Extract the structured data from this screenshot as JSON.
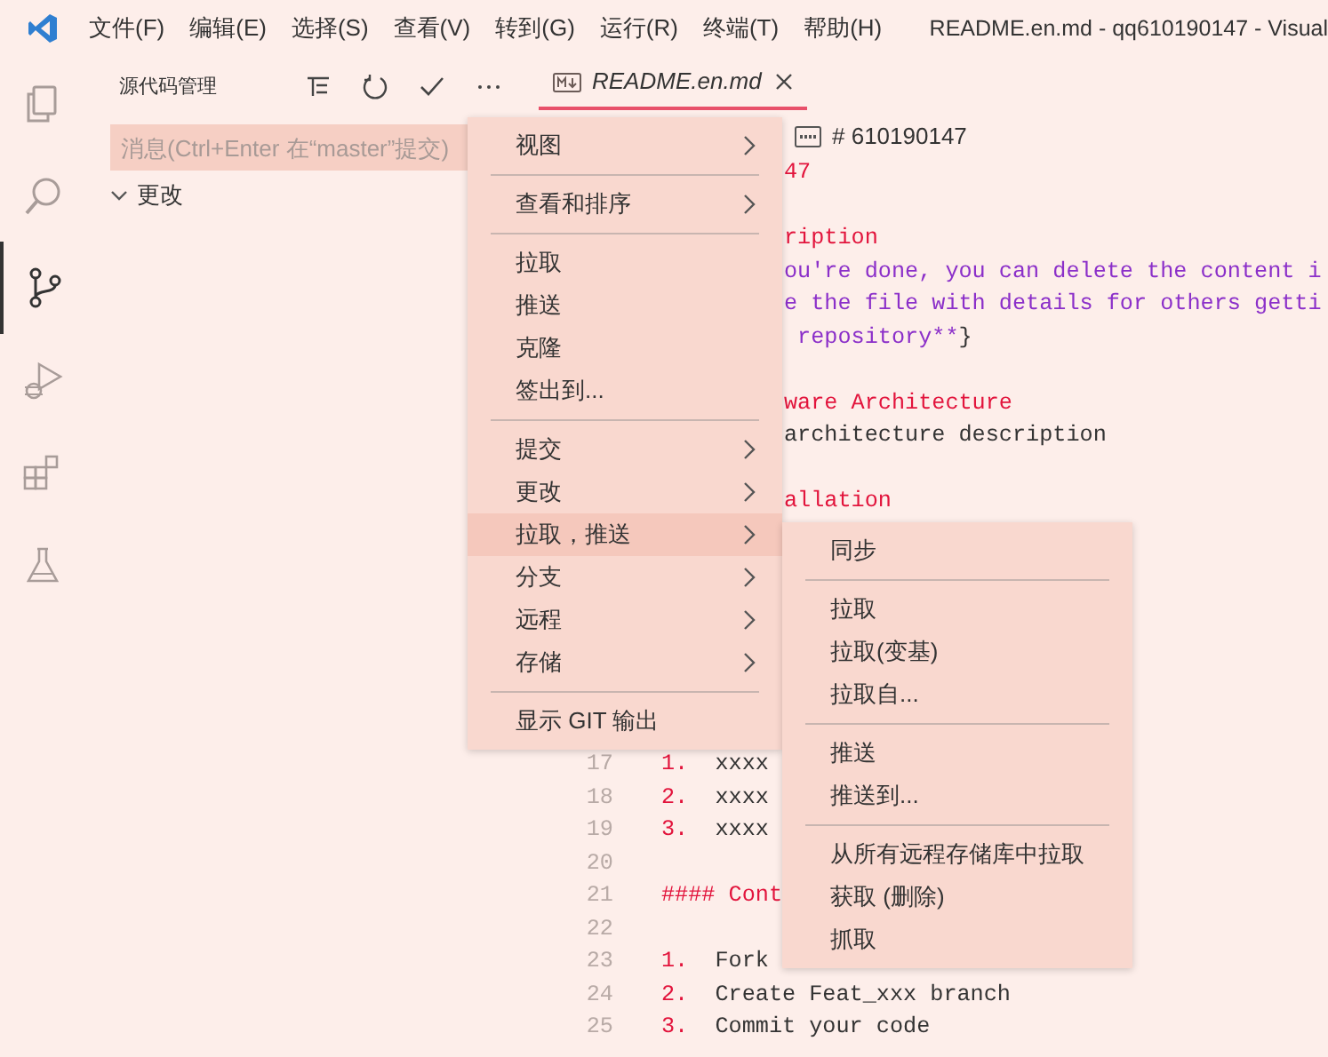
{
  "title_bar": {
    "menus": [
      "文件(F)",
      "编辑(E)",
      "选择(S)",
      "查看(V)",
      "转到(G)",
      "运行(R)",
      "终端(T)",
      "帮助(H)"
    ],
    "title": "README.en.md - qq610190147 - Visual"
  },
  "activity_bar": [
    {
      "selected": false
    },
    {
      "selected": false
    },
    {
      "selected": true
    },
    {
      "selected": false
    },
    {
      "selected": false
    },
    {
      "selected": false
    }
  ],
  "sidebar": {
    "title": "源代码管理",
    "commit_message": {
      "placeholder": "消息(Ctrl+Enter 在“master”提交)"
    },
    "tree": [
      {
        "label": "更改",
        "expanded": true
      }
    ]
  },
  "editor": {
    "tab": {
      "label": "README.en.md",
      "selected": true
    },
    "breadcrumb": "# 610190147",
    "rows": [
      {
        "kind": "clipped",
        "parts": [
          {
            "kind": "heading",
            "text": "47"
          }
        ]
      },
      {
        "kind": "blank"
      },
      {
        "kind": "clipped",
        "parts": [
          {
            "kind": "heading",
            "text": "ription"
          }
        ]
      },
      {
        "kind": "clipped",
        "parts": [
          {
            "kind": "emphasis",
            "text": "ou're done, you can delete the content i"
          }
        ]
      },
      {
        "kind": "clipped",
        "parts": [
          {
            "kind": "emphasis",
            "text": "e the file with details for others getti"
          }
        ]
      },
      {
        "kind": "clipped",
        "parts": [
          {
            "kind": "emphasis",
            "text": " repository**"
          },
          {
            "kind": "plain",
            "text": "}"
          }
        ]
      },
      {
        "kind": "blank"
      },
      {
        "kind": "clipped",
        "parts": [
          {
            "kind": "heading",
            "text": "ware Architecture"
          }
        ]
      },
      {
        "kind": "clipped",
        "parts": [
          {
            "kind": "plain",
            "text": "architecture description"
          }
        ]
      },
      {
        "kind": "blank"
      },
      {
        "kind": "clipped",
        "parts": [
          {
            "kind": "heading",
            "text": "allation"
          }
        ]
      },
      {
        "kind": "blank"
      },
      {
        "kind": "blank"
      },
      {
        "kind": "blank"
      },
      {
        "kind": "blank"
      },
      {
        "kind": "blank"
      },
      {
        "kind": "blank"
      },
      {
        "kind": "blank"
      },
      {
        "kind": "numbered",
        "number": "17",
        "parts": [
          {
            "kind": "marker",
            "text": "1."
          },
          {
            "kind": "plain",
            "text": "xxxx"
          }
        ]
      },
      {
        "kind": "numbered",
        "number": "18",
        "parts": [
          {
            "kind": "marker",
            "text": "2."
          },
          {
            "kind": "plain",
            "text": "xxxx"
          }
        ]
      },
      {
        "kind": "numbered",
        "number": "19",
        "parts": [
          {
            "kind": "marker",
            "text": "3."
          },
          {
            "kind": "plain",
            "text": "xxxx"
          }
        ]
      },
      {
        "kind": "numbered",
        "number": "20"
      },
      {
        "kind": "numbered",
        "number": "21",
        "parts": [
          {
            "kind": "heading",
            "text": "#### Cont"
          }
        ]
      },
      {
        "kind": "numbered",
        "number": "22"
      },
      {
        "kind": "numbered",
        "number": "23",
        "parts": [
          {
            "kind": "marker",
            "text": "1."
          },
          {
            "kind": "plain",
            "text": "Fork"
          }
        ]
      },
      {
        "kind": "numbered",
        "number": "24",
        "parts": [
          {
            "kind": "marker",
            "text": "2."
          },
          {
            "kind": "plain",
            "text": "Create Feat_xxx branch"
          }
        ]
      },
      {
        "kind": "numbered",
        "number": "25",
        "parts": [
          {
            "kind": "marker",
            "text": "3."
          },
          {
            "kind": "plain",
            "text": "Commit your code"
          }
        ]
      }
    ]
  },
  "menu": {
    "groups": [
      {
        "items": [
          {
            "label": "视图",
            "submenu": true,
            "selected": false
          }
        ]
      },
      {
        "items": [
          {
            "label": "查看和排序",
            "submenu": true,
            "selected": false
          }
        ]
      },
      {
        "items": [
          {
            "label": "拉取",
            "submenu": false,
            "selected": false
          },
          {
            "label": "推送",
            "submenu": false,
            "selected": false
          },
          {
            "label": "克隆",
            "submenu": false,
            "selected": false
          },
          {
            "label": "签出到...",
            "submenu": false,
            "selected": false
          }
        ]
      },
      {
        "items": [
          {
            "label": "提交",
            "submenu": true,
            "selected": false
          },
          {
            "label": "更改",
            "submenu": true,
            "selected": false
          },
          {
            "label": "拉取，推送",
            "submenu": true,
            "selected": true
          },
          {
            "label": "分支",
            "submenu": true,
            "selected": false
          },
          {
            "label": "远程",
            "submenu": true,
            "selected": false
          },
          {
            "label": "存储",
            "submenu": true,
            "selected": false
          }
        ]
      },
      {
        "items": [
          {
            "label": "显示 GIT 输出",
            "submenu": false,
            "selected": false
          }
        ]
      }
    ]
  },
  "submenu": {
    "groups": [
      {
        "items": [
          {
            "label": "同步",
            "selected": false
          }
        ]
      },
      {
        "items": [
          {
            "label": "拉取",
            "selected": false
          },
          {
            "label": "拉取(变基)",
            "selected": false
          },
          {
            "label": "拉取自...",
            "selected": false
          }
        ]
      },
      {
        "items": [
          {
            "label": "推送",
            "selected": false
          },
          {
            "label": "推送到...",
            "selected": false
          }
        ]
      },
      {
        "items": [
          {
            "label": "从所有远程存储库中拉取",
            "selected": false
          },
          {
            "label": "获取 (删除)",
            "selected": false
          },
          {
            "label": "抓取",
            "selected": false
          }
        ]
      }
    ]
  }
}
